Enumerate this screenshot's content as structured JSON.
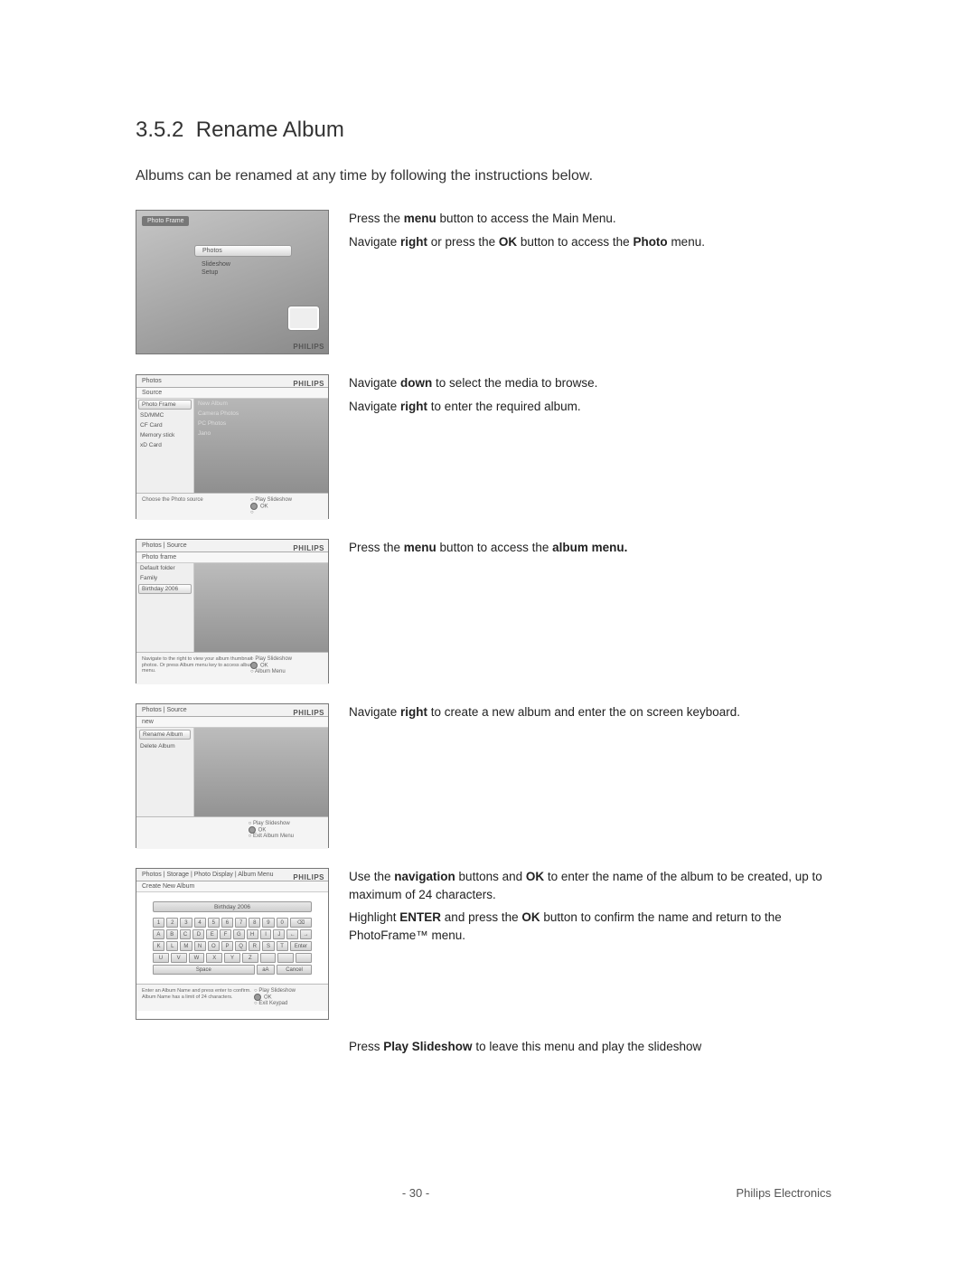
{
  "section": {
    "number": "3.5.2",
    "title": "Rename Album",
    "intro": "Albums can be renamed at any time by following the instructions below."
  },
  "brand": "PHILIPS",
  "steps": {
    "s1": {
      "frame_title": "Photo Frame",
      "menu": {
        "selected": "Photos",
        "row2": "Slideshow",
        "row3": "Setup"
      },
      "desc": {
        "p1a": "Press the ",
        "p1b": "menu",
        "p1c": " button to access the Main Menu.",
        "p2a": "Navigate ",
        "p2b": "right",
        "p2c": " or press the ",
        "p2d": "OK",
        "p2e": " button to access the ",
        "p2f": "Photo",
        "p2g": " menu."
      }
    },
    "s2": {
      "hdr": "Photos",
      "hdr2": "Source",
      "col_l": {
        "sel": "Photo Frame",
        "r1": "SD/MMC",
        "r2": "CF Card",
        "r3": "Memory stick",
        "r4": "xD Card"
      },
      "col_r": {
        "r0": "New Album",
        "r1": "Camera Photos",
        "r2": "PC Photos",
        "r3": "Jano"
      },
      "ftr_hint": "Choose the Photo source",
      "ftr_r1": "Play Slideshow",
      "ftr_r2": "OK",
      "desc": {
        "p1a": "Navigate ",
        "p1b": "down",
        "p1c": " to select the media to browse.",
        "p2a": "Navigate ",
        "p2b": "right",
        "p2c": " to enter the required album."
      }
    },
    "s3": {
      "hdr": "Photos | Source",
      "hdr2": "Photo frame",
      "col_l": {
        "r0": "Default folder",
        "r1": "Family",
        "sel": "Birthday 2006"
      },
      "ftr_hint": "Navigate to the right to view your album thumbnail photos. Or press Album menu key to access album menu.",
      "ftr_r1": "Play Slideshow",
      "ftr_r2": "OK",
      "ftr_r3": "Album Menu",
      "desc": {
        "p1a": "Press the ",
        "p1b": "menu",
        "p1c": " button to access the ",
        "p1d": "album menu."
      }
    },
    "s4": {
      "hdr": "Photos | Source",
      "hdr2": "new",
      "col_l": {
        "sel": "Rename Album",
        "r1": "Delete Album"
      },
      "ftr_r1": "Play Slideshow",
      "ftr_r2": "OK",
      "ftr_r3": "Exit Album Menu",
      "desc": {
        "p1a": "Navigate ",
        "p1b": "right",
        "p1c": " to create a new album and enter the on screen keyboard."
      }
    },
    "s5": {
      "hdr": "Photos | Storage | Photo Display | Album Menu",
      "hdr2": "Create New Album",
      "input_value": "Birthday  2006",
      "kbd": {
        "row1": [
          "1",
          "2",
          "3",
          "4",
          "5",
          "6",
          "7",
          "8",
          "9",
          "0"
        ],
        "row2": [
          "A",
          "B",
          "C",
          "D",
          "E",
          "F",
          "G",
          "H",
          "I",
          "J"
        ],
        "row3": [
          "K",
          "L",
          "M",
          "N",
          "O",
          "P",
          "Q",
          "R",
          "S",
          "T"
        ],
        "row4": [
          "U",
          "V",
          "W",
          "X",
          "Y",
          "Z",
          "",
          "",
          ""
        ],
        "side": {
          "bksp": "⌫",
          "left": "←",
          "right": "→",
          "enter": "Enter",
          "aA": "aA",
          "cancel": "Cancel",
          "space": "Space"
        }
      },
      "ftr_hint": "Enter an Album Name and press enter to confirm. Album Name has a limit of 24 characters.",
      "ftr_r1": "Play Slideshow",
      "ftr_r2": "OK",
      "ftr_r3": "Exit Keypad",
      "desc": {
        "p1a": "Use the ",
        "p1b": "navigation",
        "p1c": " buttons and ",
        "p1d": "OK",
        "p1e": " to enter the name of the album to be created, up to maximum of 24 characters.",
        "p2a": "Highlight ",
        "p2b": "ENTER",
        "p2c": " and press the ",
        "p2d": "OK",
        "p2e": " button to confirm the name and return to the PhotoFrame™ menu."
      }
    }
  },
  "closing": {
    "a": "Press ",
    "b": "Play Slideshow",
    "c": " to leave this menu and play the slideshow"
  },
  "footer": {
    "page": "- 30 -",
    "company": "Philips Electronics"
  }
}
